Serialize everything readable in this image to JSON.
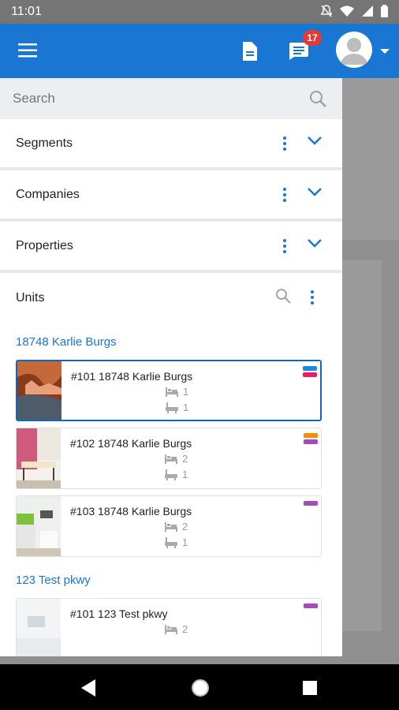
{
  "status": {
    "time": "11:01"
  },
  "appbar": {
    "badge_count": "17",
    "accent": "#1976d2"
  },
  "search": {
    "placeholder": "Search"
  },
  "sections": [
    {
      "label": "Segments"
    },
    {
      "label": "Companies"
    },
    {
      "label": "Properties"
    }
  ],
  "units": {
    "label": "Units",
    "groups": [
      {
        "name": "18748 Karlie Burgs",
        "items": [
          {
            "title": "#101 18748 Karlie Burgs",
            "beds": "1",
            "baths": "1",
            "tags": [
              "#1e88e5",
              "#e91e63"
            ],
            "selected": true
          },
          {
            "title": "#102 18748 Karlie Burgs",
            "beds": "2",
            "baths": "1",
            "tags": [
              "#fb8c00",
              "#ab47bc"
            ]
          },
          {
            "title": "#103 18748 Karlie Burgs",
            "beds": "2",
            "baths": "1",
            "tags": [
              "#ab47bc"
            ]
          }
        ]
      },
      {
        "name": "123 Test pkwy",
        "items": [
          {
            "title": "#101 123 Test pkwy",
            "beds": "2",
            "tags": [
              "#ab47bc"
            ]
          }
        ]
      }
    ]
  }
}
